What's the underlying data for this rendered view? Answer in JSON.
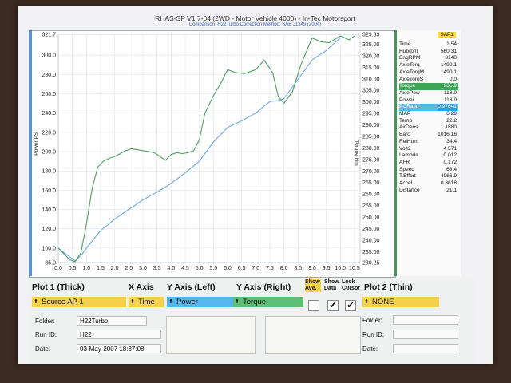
{
  "header": {
    "title": "RHAS-SP V1.7-04   (2WD - Motor Vehicle 4000) - In-Tec Motorsport",
    "subtitle": "Comparison: H22Turbo     Correction Method: SAE J1349 (2004)"
  },
  "chart_data": {
    "type": "line",
    "x_ticks": [
      "0.0",
      "0.5",
      "1.0",
      "1.5",
      "2.0",
      "2.5",
      "3.0",
      "3.5",
      "4.0",
      "4.5",
      "5.0",
      "5.5",
      "6.0",
      "6.5",
      "7.0",
      "7.5",
      "8.0",
      "8.5",
      "9.0",
      "9.5",
      "10.0",
      "10.5"
    ],
    "y_left_ticks": [
      "321.7",
      "300.0",
      "280.0",
      "260.0",
      "240.0",
      "220.0",
      "200.0",
      "180.0",
      "160.0",
      "140.0",
      "120.0",
      "100.0",
      "85.0"
    ],
    "y_right_ticks": [
      "329.33",
      "325.00",
      "320.00",
      "315.00",
      "310.00",
      "305.00",
      "300.00",
      "295.00",
      "290.00",
      "285.00",
      "280.00",
      "275.00",
      "270.00",
      "265.00",
      "260.00",
      "255.00",
      "250.00",
      "245.00",
      "240.00",
      "235.00",
      "230.25"
    ],
    "ylabel_left": "Power PS",
    "ylabel_right": "Torque Nm",
    "xlim": [
      0,
      10.7
    ],
    "ylim_left": [
      85,
      321.7
    ],
    "ylim_right": [
      230.25,
      329.33
    ],
    "grid": true,
    "series": [
      {
        "axis": "left",
        "color": "#6aa8e6",
        "x": [
          0.0,
          0.3,
          0.6,
          0.8,
          1.0,
          1.5,
          2.0,
          2.5,
          3.0,
          3.5,
          4.0,
          4.5,
          5.0,
          5.5,
          6.0,
          6.5,
          7.0,
          7.5,
          7.8,
          8.0,
          8.5,
          9.0,
          9.5,
          10.0,
          10.5
        ],
        "y": [
          100,
          93,
          87,
          92,
          100,
          118,
          130,
          140,
          150,
          158,
          167,
          178,
          190,
          210,
          225,
          232,
          240,
          252,
          253,
          255,
          275,
          295,
          305,
          318,
          318
        ]
      },
      {
        "axis": "left",
        "color": "#4d9f61",
        "x": [
          0.0,
          0.2,
          0.4,
          0.6,
          0.8,
          1.0,
          1.2,
          1.4,
          1.6,
          1.8,
          2.0,
          2.2,
          2.4,
          2.6,
          2.8,
          3.0,
          3.2,
          3.4,
          3.6,
          3.8,
          4.0,
          4.2,
          4.4,
          4.6,
          4.8,
          5.0,
          5.2,
          5.5,
          5.8,
          6.0,
          6.3,
          6.6,
          7.0,
          7.3,
          7.6,
          7.8,
          8.0,
          8.3,
          8.6,
          9.0,
          9.3,
          9.6,
          10.0,
          10.3,
          10.5
        ],
        "y": [
          100,
          94,
          88,
          86,
          95,
          125,
          162,
          184,
          190,
          193,
          195,
          198,
          201,
          203,
          202,
          201,
          200,
          199,
          195,
          191,
          197,
          199,
          198,
          199,
          201,
          212,
          240,
          258,
          273,
          285,
          282,
          281,
          285,
          295,
          282,
          257,
          250,
          262,
          290,
          318,
          314,
          313,
          320,
          316,
          320
        ]
      }
    ]
  },
  "side_panel": {
    "header": "SAP1",
    "rows": [
      {
        "k": "Time",
        "v": "1.54",
        "hl": ""
      },
      {
        "k": "Hubrpm",
        "v": "560.31",
        "hl": ""
      },
      {
        "k": "EngRPM",
        "v": "3140",
        "hl": ""
      },
      {
        "k": "AxleTorq",
        "v": "1490.1",
        "hl": ""
      },
      {
        "k": "AxleTorqM",
        "v": "1490.1",
        "hl": ""
      },
      {
        "k": "AxleTorqS",
        "v": "0.0",
        "hl": ""
      },
      {
        "k": "Torque",
        "v": "265.9",
        "hl": "green"
      },
      {
        "k": "AxlePow",
        "v": "118.9",
        "hl": ""
      },
      {
        "k": "Power",
        "v": "118.9",
        "hl": ""
      },
      {
        "k": "PCRatio",
        "v": "0.97641",
        "hl": "blue"
      },
      {
        "k": "MAP",
        "v": "6.29",
        "hl": ""
      },
      {
        "k": "Temp",
        "v": "22.2",
        "hl": ""
      },
      {
        "k": "AirDens",
        "v": "1.1880",
        "hl": ""
      },
      {
        "k": "Baro",
        "v": "1016.16",
        "hl": ""
      },
      {
        "k": "RelHum",
        "v": "34.4",
        "hl": ""
      },
      {
        "k": "Volt2",
        "v": "4.571",
        "hl": ""
      },
      {
        "k": "Lambda",
        "v": "0.012",
        "hl": ""
      },
      {
        "k": "AFR",
        "v": "0.172",
        "hl": ""
      },
      {
        "k": "Speed",
        "v": "63.4",
        "hl": ""
      },
      {
        "k": "T.Effort",
        "v": "4966.9",
        "hl": ""
      },
      {
        "k": "Accel",
        "v": "0.3618",
        "hl": ""
      },
      {
        "k": "Distance",
        "v": "21.1",
        "hl": ""
      }
    ]
  },
  "controls": {
    "plot1_label": "Plot 1 (Thick)",
    "xaxis_label": "X Axis",
    "yleft_label": "Y Axis (Left)",
    "yright_label": "Y Axis (Right)",
    "show_ave_label": "Show Ave.",
    "show_data_label": "Show Data",
    "lock_cursor_label": "Lock Cursor",
    "plot2_label": "Plot 2 (Thin)",
    "plot1_value": "Source AP 1",
    "xaxis_value": "Time",
    "yleft_value": "Power",
    "yright_value": "Torque",
    "plot2_value": "NONE",
    "folder_label": "Folder:",
    "runid_label": "Run ID:",
    "date_label": "Date:",
    "folder_value": "H22Turbo",
    "runid_value": "H22",
    "date_value": "03-May-2007   18:37:08",
    "folder2_label": "Folder:",
    "runid2_label": "Run ID:",
    "date2_label": "Date:"
  }
}
